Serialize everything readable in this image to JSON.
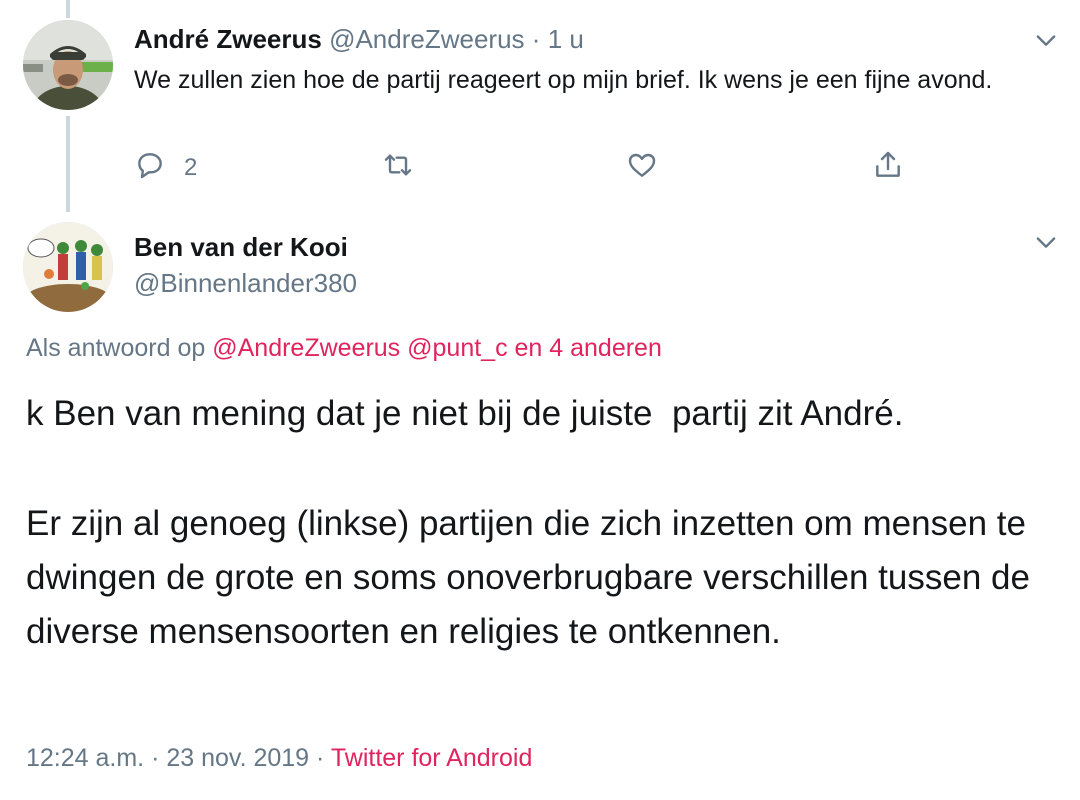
{
  "tweet1": {
    "name": "André Zweerus",
    "handle": "@AndreZweerus",
    "separator": "·",
    "time": "1 u",
    "text": "We zullen zien hoe de partij reageert op mijn brief. Ik wens je een fijne avond.",
    "reply_count": "2"
  },
  "tweet2": {
    "name": "Ben van der Kooi",
    "handle": "@Binnenlander380",
    "reply_prefix": "Als antwoord op",
    "reply_mentions": "@AndreZweerus @punt_c en 4 anderen",
    "paragraph1": "k Ben van mening dat je niet bij de juiste  partij zit André.",
    "paragraph2": "Er zijn al genoeg (linkse) partijen die zich inzetten om mensen te dwingen de grote en soms onoverbrugbare verschillen tussen de diverse mensensoorten en religies te ontkennen.",
    "time": "12:24 a.m.",
    "date": "23 nov. 2019",
    "dot": "·",
    "source": "Twitter for Android"
  },
  "icons": {
    "caret": "chevron-down-icon",
    "reply": "comment-bubble-icon",
    "retweet": "retweet-icon",
    "like": "heart-icon",
    "share": "share-icon"
  },
  "colors": {
    "text": "#14171a",
    "muted": "#657786",
    "link": "#e0245e",
    "thread_line": "#ccd6dd"
  }
}
